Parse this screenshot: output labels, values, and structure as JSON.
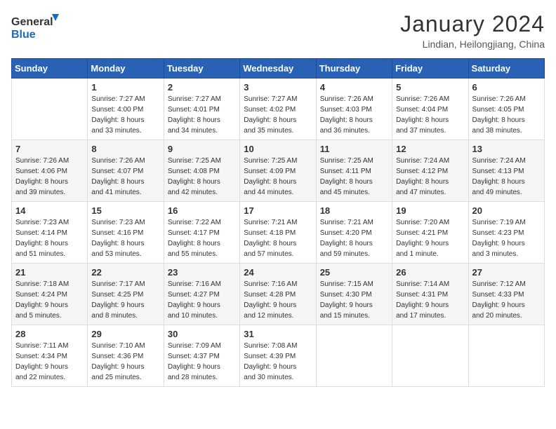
{
  "logo": {
    "line1": "General",
    "line2": "Blue"
  },
  "title": "January 2024",
  "subtitle": "Lindian, Heilongjiang, China",
  "header_days": [
    "Sunday",
    "Monday",
    "Tuesday",
    "Wednesday",
    "Thursday",
    "Friday",
    "Saturday"
  ],
  "weeks": [
    [
      {
        "day": "",
        "info": ""
      },
      {
        "day": "1",
        "info": "Sunrise: 7:27 AM\nSunset: 4:00 PM\nDaylight: 8 hours\nand 33 minutes."
      },
      {
        "day": "2",
        "info": "Sunrise: 7:27 AM\nSunset: 4:01 PM\nDaylight: 8 hours\nand 34 minutes."
      },
      {
        "day": "3",
        "info": "Sunrise: 7:27 AM\nSunset: 4:02 PM\nDaylight: 8 hours\nand 35 minutes."
      },
      {
        "day": "4",
        "info": "Sunrise: 7:26 AM\nSunset: 4:03 PM\nDaylight: 8 hours\nand 36 minutes."
      },
      {
        "day": "5",
        "info": "Sunrise: 7:26 AM\nSunset: 4:04 PM\nDaylight: 8 hours\nand 37 minutes."
      },
      {
        "day": "6",
        "info": "Sunrise: 7:26 AM\nSunset: 4:05 PM\nDaylight: 8 hours\nand 38 minutes."
      }
    ],
    [
      {
        "day": "7",
        "info": "Sunrise: 7:26 AM\nSunset: 4:06 PM\nDaylight: 8 hours\nand 39 minutes."
      },
      {
        "day": "8",
        "info": "Sunrise: 7:26 AM\nSunset: 4:07 PM\nDaylight: 8 hours\nand 41 minutes."
      },
      {
        "day": "9",
        "info": "Sunrise: 7:25 AM\nSunset: 4:08 PM\nDaylight: 8 hours\nand 42 minutes."
      },
      {
        "day": "10",
        "info": "Sunrise: 7:25 AM\nSunset: 4:09 PM\nDaylight: 8 hours\nand 44 minutes."
      },
      {
        "day": "11",
        "info": "Sunrise: 7:25 AM\nSunset: 4:11 PM\nDaylight: 8 hours\nand 45 minutes."
      },
      {
        "day": "12",
        "info": "Sunrise: 7:24 AM\nSunset: 4:12 PM\nDaylight: 8 hours\nand 47 minutes."
      },
      {
        "day": "13",
        "info": "Sunrise: 7:24 AM\nSunset: 4:13 PM\nDaylight: 8 hours\nand 49 minutes."
      }
    ],
    [
      {
        "day": "14",
        "info": "Sunrise: 7:23 AM\nSunset: 4:14 PM\nDaylight: 8 hours\nand 51 minutes."
      },
      {
        "day": "15",
        "info": "Sunrise: 7:23 AM\nSunset: 4:16 PM\nDaylight: 8 hours\nand 53 minutes."
      },
      {
        "day": "16",
        "info": "Sunrise: 7:22 AM\nSunset: 4:17 PM\nDaylight: 8 hours\nand 55 minutes."
      },
      {
        "day": "17",
        "info": "Sunrise: 7:21 AM\nSunset: 4:18 PM\nDaylight: 8 hours\nand 57 minutes."
      },
      {
        "day": "18",
        "info": "Sunrise: 7:21 AM\nSunset: 4:20 PM\nDaylight: 8 hours\nand 59 minutes."
      },
      {
        "day": "19",
        "info": "Sunrise: 7:20 AM\nSunset: 4:21 PM\nDaylight: 9 hours\nand 1 minute."
      },
      {
        "day": "20",
        "info": "Sunrise: 7:19 AM\nSunset: 4:23 PM\nDaylight: 9 hours\nand 3 minutes."
      }
    ],
    [
      {
        "day": "21",
        "info": "Sunrise: 7:18 AM\nSunset: 4:24 PM\nDaylight: 9 hours\nand 5 minutes."
      },
      {
        "day": "22",
        "info": "Sunrise: 7:17 AM\nSunset: 4:25 PM\nDaylight: 9 hours\nand 8 minutes."
      },
      {
        "day": "23",
        "info": "Sunrise: 7:16 AM\nSunset: 4:27 PM\nDaylight: 9 hours\nand 10 minutes."
      },
      {
        "day": "24",
        "info": "Sunrise: 7:16 AM\nSunset: 4:28 PM\nDaylight: 9 hours\nand 12 minutes."
      },
      {
        "day": "25",
        "info": "Sunrise: 7:15 AM\nSunset: 4:30 PM\nDaylight: 9 hours\nand 15 minutes."
      },
      {
        "day": "26",
        "info": "Sunrise: 7:14 AM\nSunset: 4:31 PM\nDaylight: 9 hours\nand 17 minutes."
      },
      {
        "day": "27",
        "info": "Sunrise: 7:12 AM\nSunset: 4:33 PM\nDaylight: 9 hours\nand 20 minutes."
      }
    ],
    [
      {
        "day": "28",
        "info": "Sunrise: 7:11 AM\nSunset: 4:34 PM\nDaylight: 9 hours\nand 22 minutes."
      },
      {
        "day": "29",
        "info": "Sunrise: 7:10 AM\nSunset: 4:36 PM\nDaylight: 9 hours\nand 25 minutes."
      },
      {
        "day": "30",
        "info": "Sunrise: 7:09 AM\nSunset: 4:37 PM\nDaylight: 9 hours\nand 28 minutes."
      },
      {
        "day": "31",
        "info": "Sunrise: 7:08 AM\nSunset: 4:39 PM\nDaylight: 9 hours\nand 30 minutes."
      },
      {
        "day": "",
        "info": ""
      },
      {
        "day": "",
        "info": ""
      },
      {
        "day": "",
        "info": ""
      }
    ]
  ]
}
